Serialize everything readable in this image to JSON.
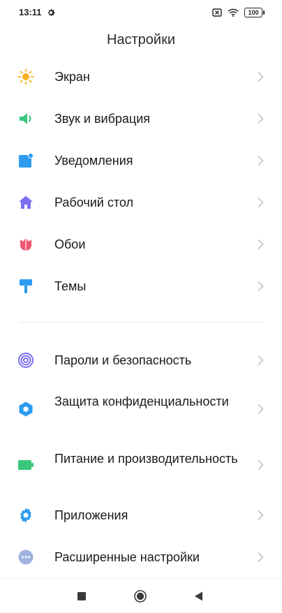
{
  "status": {
    "time": "13:11",
    "battery": "100"
  },
  "title": "Настройки",
  "items": [
    {
      "label": "Экран",
      "icon": "sun-icon",
      "color": "#f6b321"
    },
    {
      "label": "Звук и вибрация",
      "icon": "speaker-icon",
      "color": "#38c77b"
    },
    {
      "label": "Уведомления",
      "icon": "notifications-icon",
      "color": "#2d9bf0"
    },
    {
      "label": "Рабочий стол",
      "icon": "home-icon",
      "color": "#7b6ff2"
    },
    {
      "label": "Обои",
      "icon": "tulip-icon",
      "color": "#f0566f"
    },
    {
      "label": "Темы",
      "icon": "brush-icon",
      "color": "#2d9bf0"
    },
    {
      "label": "Пароли и безопасность",
      "icon": "fingerprint-icon",
      "color": "#7b6ff2"
    },
    {
      "label": "Защита конфиденциальности",
      "icon": "shield-icon",
      "color": "#2d9bf0"
    },
    {
      "label": "Питание и производительность",
      "icon": "battery-icon",
      "color": "#38c77b"
    },
    {
      "label": "Приложения",
      "icon": "gear-icon",
      "color": "#2d9bf0"
    },
    {
      "label": "Расширенные настройки",
      "icon": "more-icon",
      "color": "#9fb3de"
    }
  ]
}
